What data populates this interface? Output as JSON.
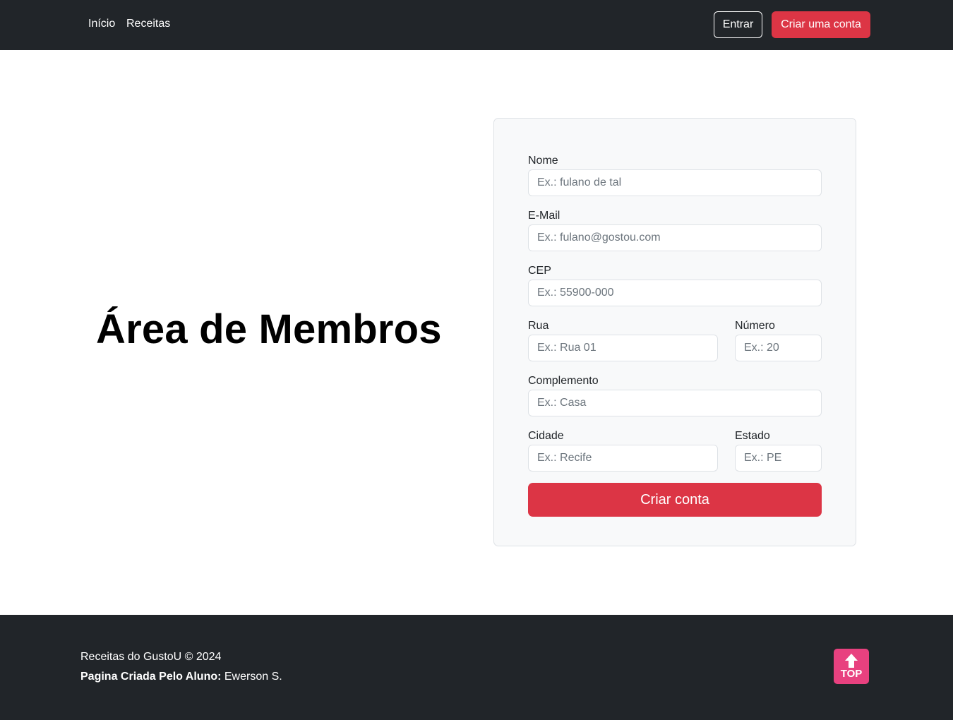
{
  "nav": {
    "links": [
      "Início",
      "Receitas"
    ],
    "login_label": "Entrar",
    "signup_label": "Criar uma conta"
  },
  "hero": {
    "title": "Área de Membros"
  },
  "form": {
    "fields": {
      "nome": {
        "label": "Nome",
        "placeholder": "Ex.: fulano de tal"
      },
      "email": {
        "label": "E-Mail",
        "placeholder": "Ex.: fulano@gostou.com"
      },
      "cep": {
        "label": "CEP",
        "placeholder": "Ex.: 55900-000"
      },
      "rua": {
        "label": "Rua",
        "placeholder": "Ex.: Rua 01"
      },
      "numero": {
        "label": "Número",
        "placeholder": "Ex.: 20"
      },
      "complemento": {
        "label": "Complemento",
        "placeholder": "Ex.: Casa"
      },
      "cidade": {
        "label": "Cidade",
        "placeholder": "Ex.: Recife"
      },
      "estado": {
        "label": "Estado",
        "placeholder": "Ex.: PE"
      }
    },
    "submit_label": "Criar conta"
  },
  "footer": {
    "copyright": "Receitas do GustoU © 2024",
    "author_label": "Pagina Criada Pelo Aluno:",
    "author_name": " Ewerson S.",
    "top_button_label": "TOP",
    "top_icon": "arrow-up-icon"
  },
  "colors": {
    "navbar_bg": "#212529",
    "accent_red": "#dc3545",
    "form_bg": "#f8f9fa",
    "top_button_bg": "#e8417f"
  }
}
